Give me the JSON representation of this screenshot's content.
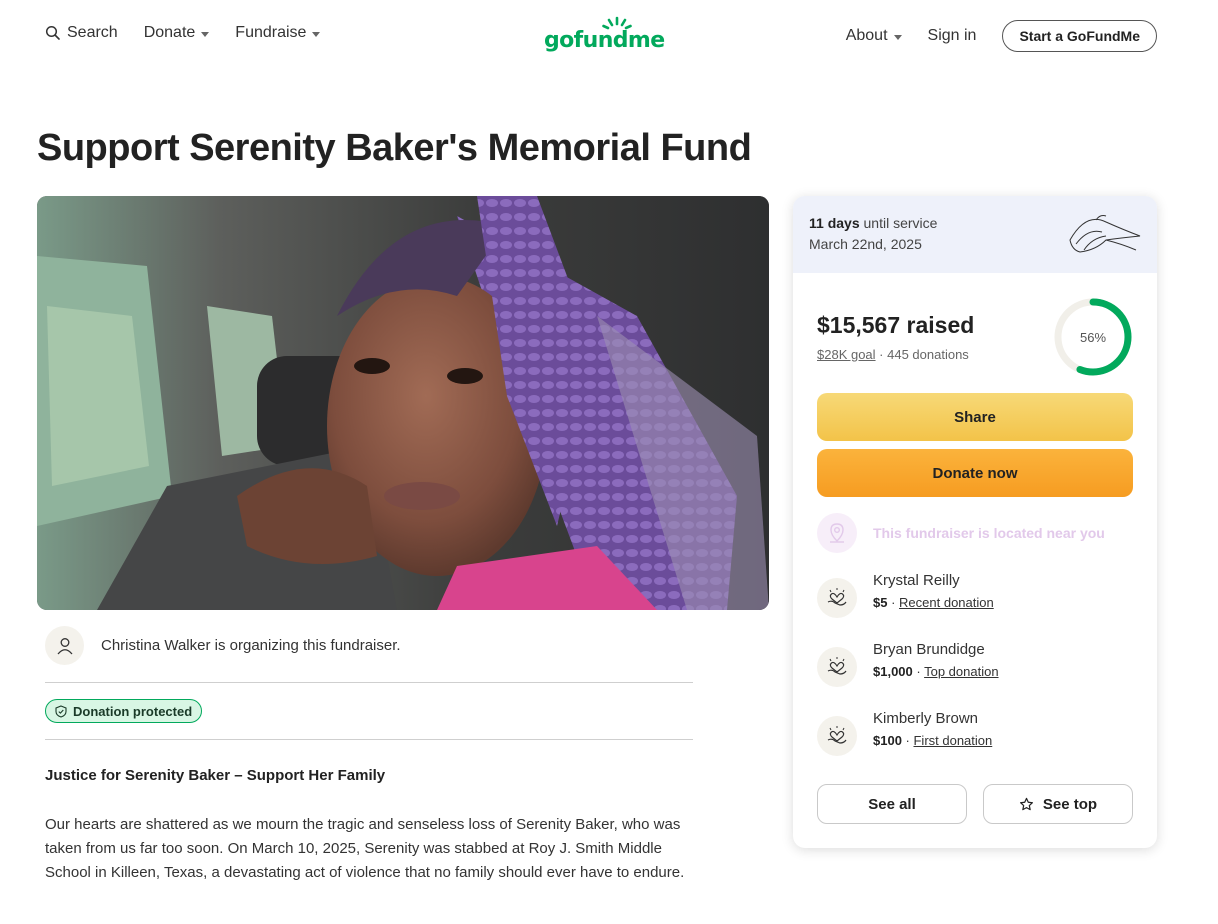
{
  "nav": {
    "search_label": "Search",
    "donate_label": "Donate",
    "fundraise_label": "Fundraise",
    "logo_text": "gofundme",
    "about_label": "About",
    "signin_label": "Sign in",
    "start_label": "Start a GoFundMe"
  },
  "campaign": {
    "title": "Support Serenity Baker's Memorial Fund",
    "organizer_text": "Christina Walker is organizing this fundraiser.",
    "protected_label": "Donation protected",
    "story_title": "Justice for Serenity Baker – Support Her Family",
    "story_paragraph": "Our hearts are shattered as we mourn the tragic and senseless loss of Serenity Baker, who was taken from us far too soon. On March 10, 2025, Serenity was stabbed at Roy J. Smith Middle School in Killeen, Texas, a devastating act of violence that no family should ever have to endure."
  },
  "card": {
    "days_bold": "11 days",
    "days_rest": " until service",
    "service_date": "March 22nd, 2025",
    "raised": "$15,567 raised",
    "goal": "$28K goal",
    "separator": " · ",
    "donations": "445 donations",
    "progress_label": "56%",
    "progress": 0.56,
    "share_label": "Share",
    "donate_label": "Donate now",
    "near_text": "This fundraiser is located near you",
    "donors": [
      {
        "name": "Krystal Reilly",
        "amount": "$5",
        "sep": " · ",
        "kind": "Recent donation"
      },
      {
        "name": "Bryan Brundidge",
        "amount": "$1,000",
        "sep": " · ",
        "kind": "Top donation"
      },
      {
        "name": "Kimberly Brown",
        "amount": "$100",
        "sep": " · ",
        "kind": "First donation"
      }
    ],
    "see_all_label": "See all",
    "see_top_label": "See top"
  },
  "colors": {
    "brand_green": "#02a95c",
    "share_yellow": "#f3c349",
    "donate_orange": "#f69c21"
  }
}
